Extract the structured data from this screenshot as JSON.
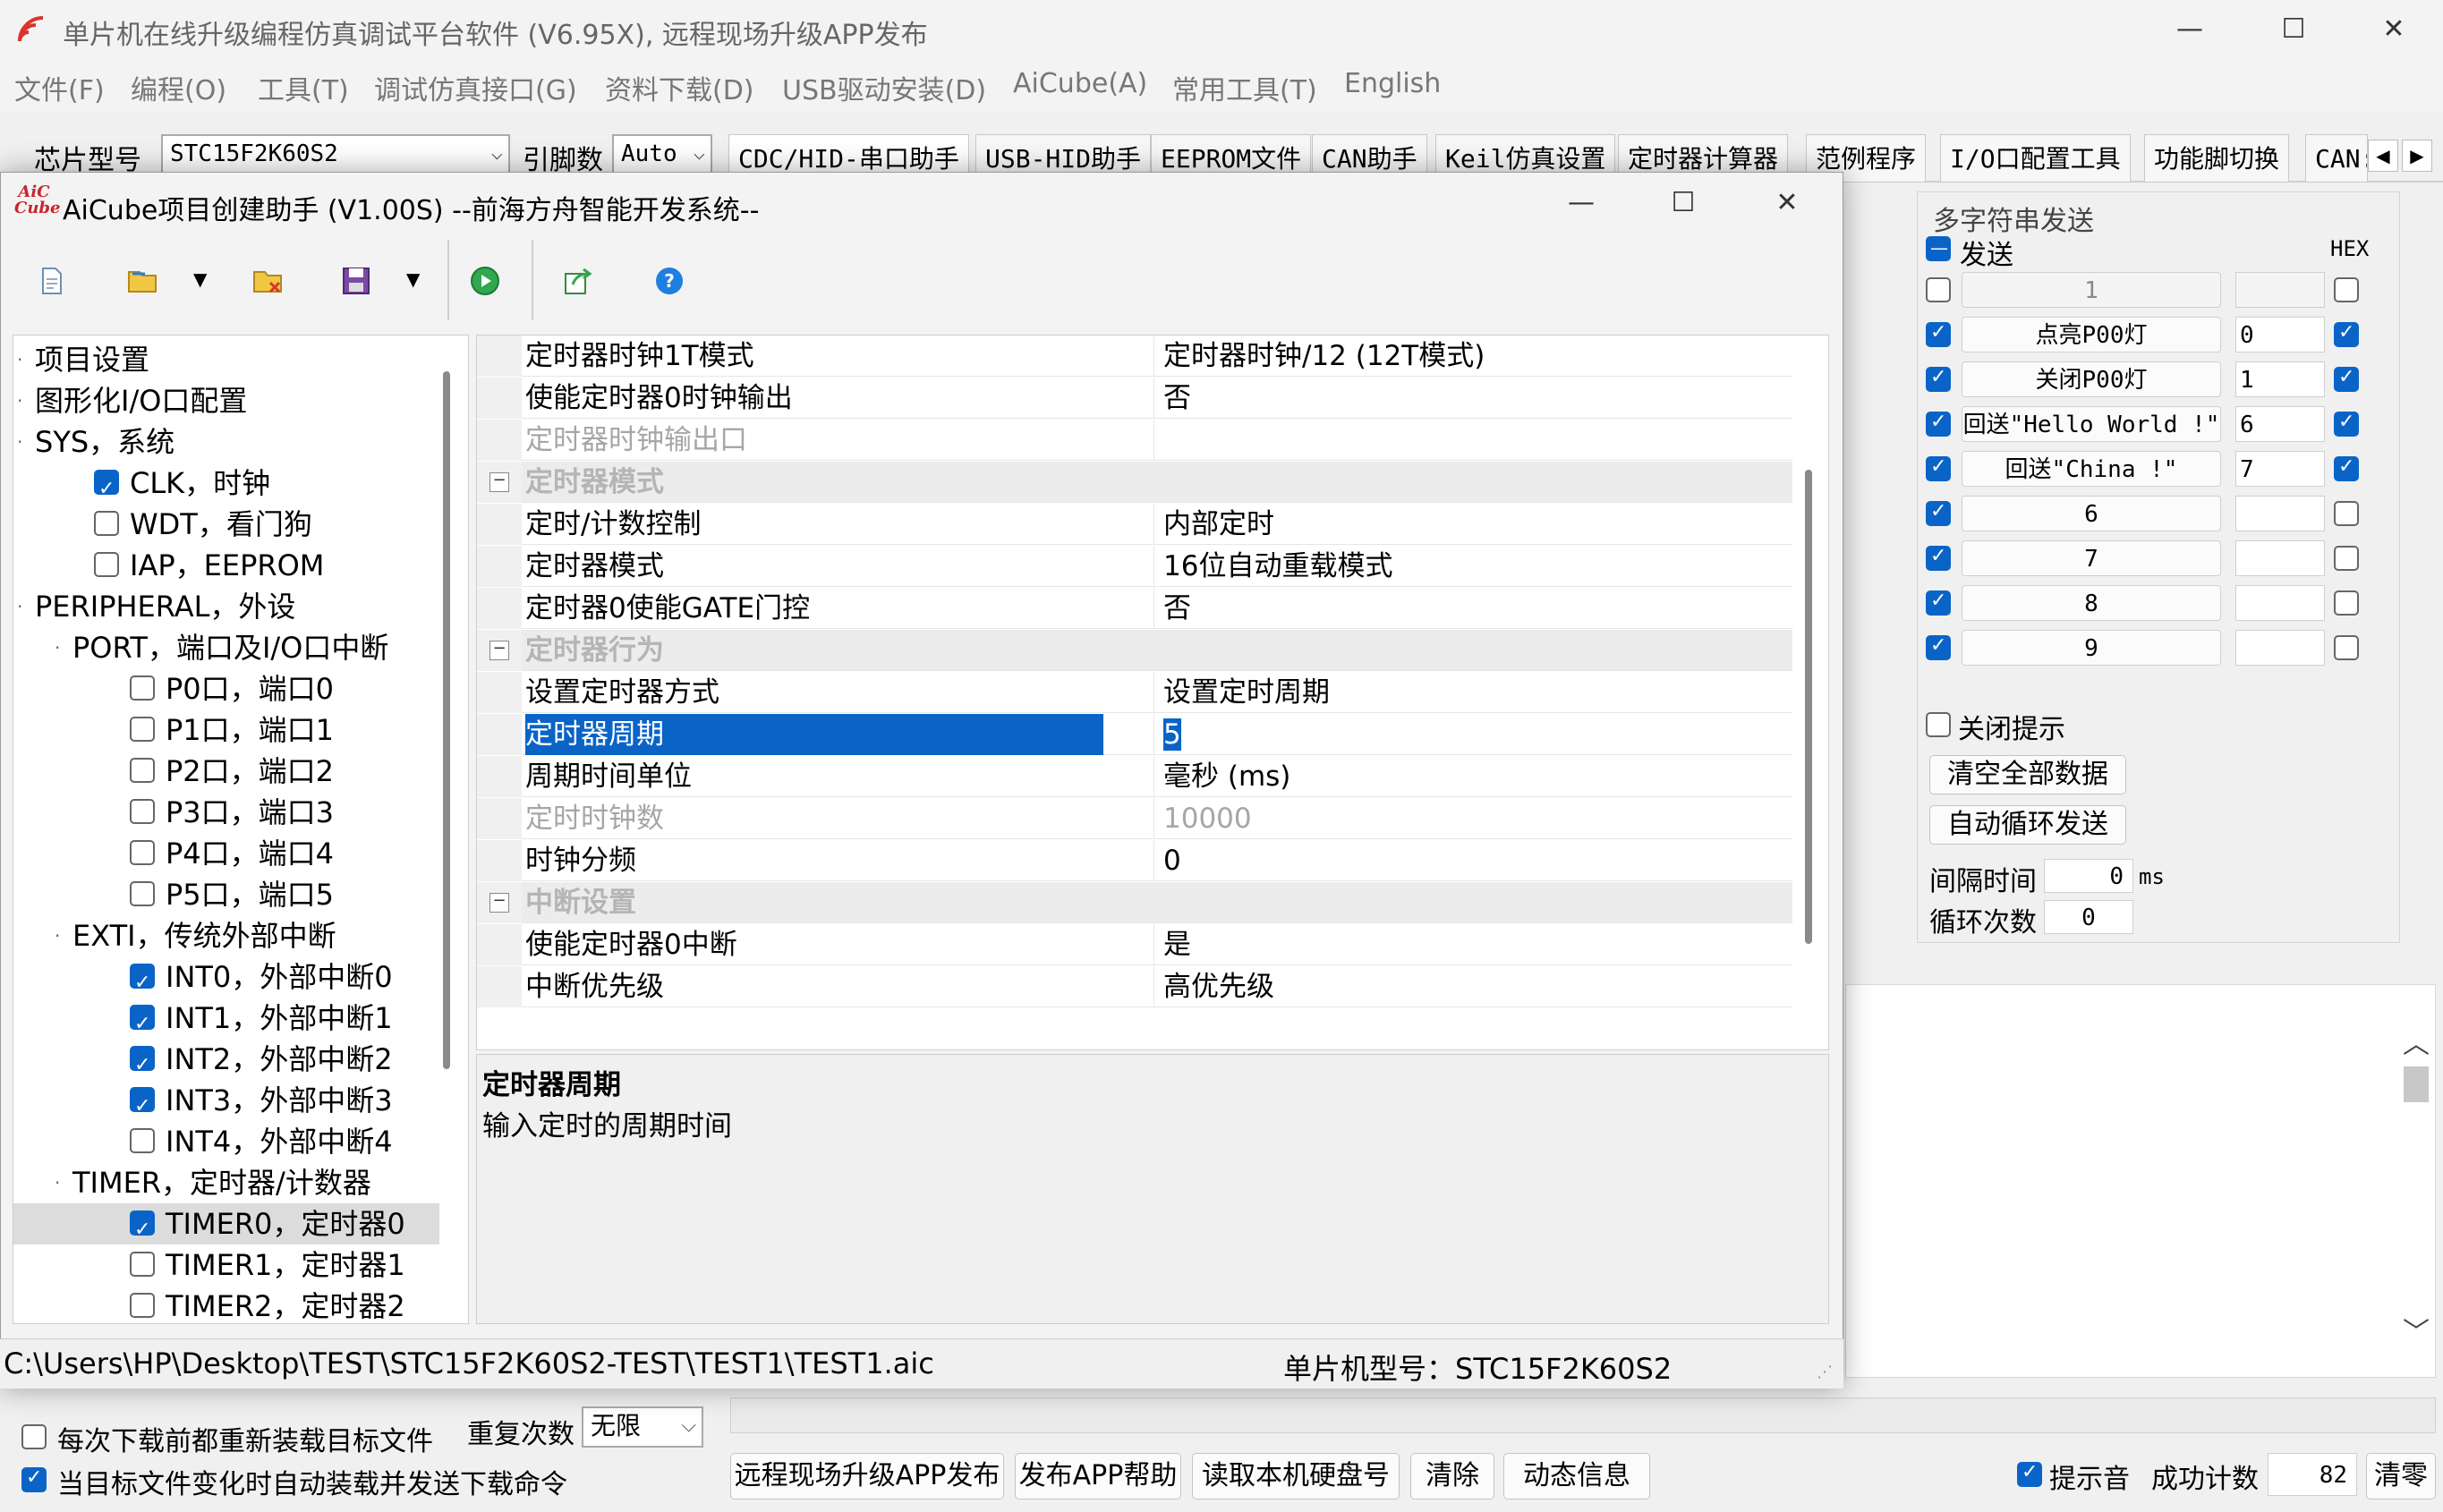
{
  "app": {
    "title": "单片机在线升级编程仿真调试平台软件 (V6.95X), 远程现场升级APP发布",
    "menu": [
      "文件(F)",
      "编程(O)",
      "工具(T)",
      "调试仿真接口(G)",
      "资料下载(D)",
      "USB驱动安装(D)",
      "AiCube(A)",
      "常用工具(T)",
      "English"
    ],
    "chip_label": "芯片型号",
    "chip_value": "STC15F2K60S2",
    "pins_label": "引脚数",
    "pins_value": "Auto",
    "tabs": [
      "CDC/HID-串口助手",
      "USB-HID助手",
      "EEPROM文件",
      "CAN助手",
      "Keil仿真设置",
      "定时器计算器",
      "范例程序",
      "I/O口配置工具",
      "功能脚切换",
      "CAN:"
    ],
    "window_buttons": {
      "minimize": "—",
      "maximize": "☐",
      "close": "✕"
    }
  },
  "multi_send": {
    "group_title": "多字符串发送",
    "send_label": "发送",
    "hex_header": "HEX",
    "rows": [
      {
        "checked": false,
        "label": "1",
        "value": "",
        "hex": false
      },
      {
        "checked": true,
        "label": "点亮P00灯",
        "value": "0",
        "hex": true
      },
      {
        "checked": true,
        "label": "关闭P00灯",
        "value": "1",
        "hex": true
      },
      {
        "checked": true,
        "label": "回送\"Hello World !\"",
        "value": "6",
        "hex": true
      },
      {
        "checked": true,
        "label": "回送\"China !\"",
        "value": "7",
        "hex": true
      },
      {
        "checked": true,
        "label": "6",
        "value": "",
        "hex": false
      },
      {
        "checked": true,
        "label": "7",
        "value": "",
        "hex": false
      },
      {
        "checked": true,
        "label": "8",
        "value": "",
        "hex": false
      },
      {
        "checked": true,
        "label": "9",
        "value": "",
        "hex": false
      }
    ],
    "close_hint": "关闭提示",
    "clear_all": "清空全部数据",
    "auto_loop": "自动循环发送",
    "interval_label": "间隔时间",
    "interval_value": "0",
    "interval_unit": "ms",
    "loop_label": "循环次数",
    "loop_value": "0"
  },
  "bottom": {
    "reload_each": "每次下载前都重新装载目标文件",
    "auto_load": "当目标文件变化时自动装载并发送下载命令",
    "repeat_label": "重复次数",
    "repeat_value": "无限",
    "buttons": [
      "远程现场升级APP发布",
      "发布APP帮助",
      "读取本机硬盘号",
      "清除",
      "动态信息"
    ],
    "tone_label": "提示音",
    "success_label": "成功计数",
    "success_value": "82",
    "clear_count": "清零"
  },
  "dialog": {
    "logo": "AiC Cube",
    "title": "AiCube项目创建助手 (V1.00S) --前海方舟智能开发系统--",
    "tree": [
      {
        "label": "项目设置",
        "level": 0,
        "check": null
      },
      {
        "label": "图形化I/O口配置",
        "level": 0,
        "check": null
      },
      {
        "label": "SYS，系统",
        "level": 0,
        "check": null
      },
      {
        "label": "CLK，时钟",
        "level": 1,
        "check": true
      },
      {
        "label": "WDT，看门狗",
        "level": 1,
        "check": false
      },
      {
        "label": "IAP，EEPROM",
        "level": 1,
        "check": false
      },
      {
        "label": "PERIPHERAL，外设",
        "level": 0,
        "check": null
      },
      {
        "label": "PORT，端口及I/O口中断",
        "level": 1,
        "check": null
      },
      {
        "label": "P0口，端口0",
        "level": 2,
        "check": false
      },
      {
        "label": "P1口，端口1",
        "level": 2,
        "check": false
      },
      {
        "label": "P2口，端口2",
        "level": 2,
        "check": false
      },
      {
        "label": "P3口，端口3",
        "level": 2,
        "check": false
      },
      {
        "label": "P4口，端口4",
        "level": 2,
        "check": false
      },
      {
        "label": "P5口，端口5",
        "level": 2,
        "check": false
      },
      {
        "label": "EXTI，传统外部中断",
        "level": 1,
        "check": null
      },
      {
        "label": "INT0，外部中断0",
        "level": 2,
        "check": true
      },
      {
        "label": "INT1，外部中断1",
        "level": 2,
        "check": true
      },
      {
        "label": "INT2，外部中断2",
        "level": 2,
        "check": true
      },
      {
        "label": "INT3，外部中断3",
        "level": 2,
        "check": true
      },
      {
        "label": "INT4，外部中断4",
        "level": 2,
        "check": false
      },
      {
        "label": "TIMER，定时器/计数器",
        "level": 1,
        "check": null
      },
      {
        "label": "TIMER0，定时器0",
        "level": 2,
        "check": true,
        "selected": true
      },
      {
        "label": "TIMER1，定时器1",
        "level": 2,
        "check": false
      },
      {
        "label": "TIMER2，定时器2",
        "level": 2,
        "check": false
      }
    ],
    "props": [
      {
        "type": "row",
        "key": "定时器时钟1T模式",
        "value": "定时器时钟/12 (12T模式)"
      },
      {
        "type": "row",
        "key": "使能定时器0时钟输出",
        "value": "否"
      },
      {
        "type": "dis",
        "key": "定时器时钟输出口",
        "value": ""
      },
      {
        "type": "cat",
        "key": "定时器模式",
        "value": ""
      },
      {
        "type": "row",
        "key": "定时/计数控制",
        "value": "内部定时"
      },
      {
        "type": "row",
        "key": "定时器模式",
        "value": "16位自动重载模式"
      },
      {
        "type": "row",
        "key": "定时器0使能GATE门控",
        "value": "否"
      },
      {
        "type": "cat",
        "key": "定时器行为",
        "value": ""
      },
      {
        "type": "row",
        "key": "设置定时器方式",
        "value": "设置定时周期"
      },
      {
        "type": "sel",
        "key": "定时器周期",
        "value": "5"
      },
      {
        "type": "row",
        "key": "周期时间单位",
        "value": "毫秒 (ms)"
      },
      {
        "type": "dis",
        "key": "定时时钟数",
        "value": "10000"
      },
      {
        "type": "row",
        "key": "时钟分频",
        "value": "0"
      },
      {
        "type": "cat",
        "key": "中断设置",
        "value": ""
      },
      {
        "type": "row",
        "key": "使能定时器0中断",
        "value": "是"
      },
      {
        "type": "row",
        "key": "中断优先级",
        "value": "高优先级"
      }
    ],
    "desc_title": "定时器周期",
    "desc_text": "输入定时的周期时间",
    "status_path": "C:\\Users\\HP\\Desktop\\TEST\\STC15F2K60S2-TEST\\TEST1\\TEST1.aic",
    "status_mcu": "单片机型号：STC15F2K60S2"
  },
  "colors": {
    "accent": "#0a64c8",
    "title_red": "#d9342b"
  }
}
